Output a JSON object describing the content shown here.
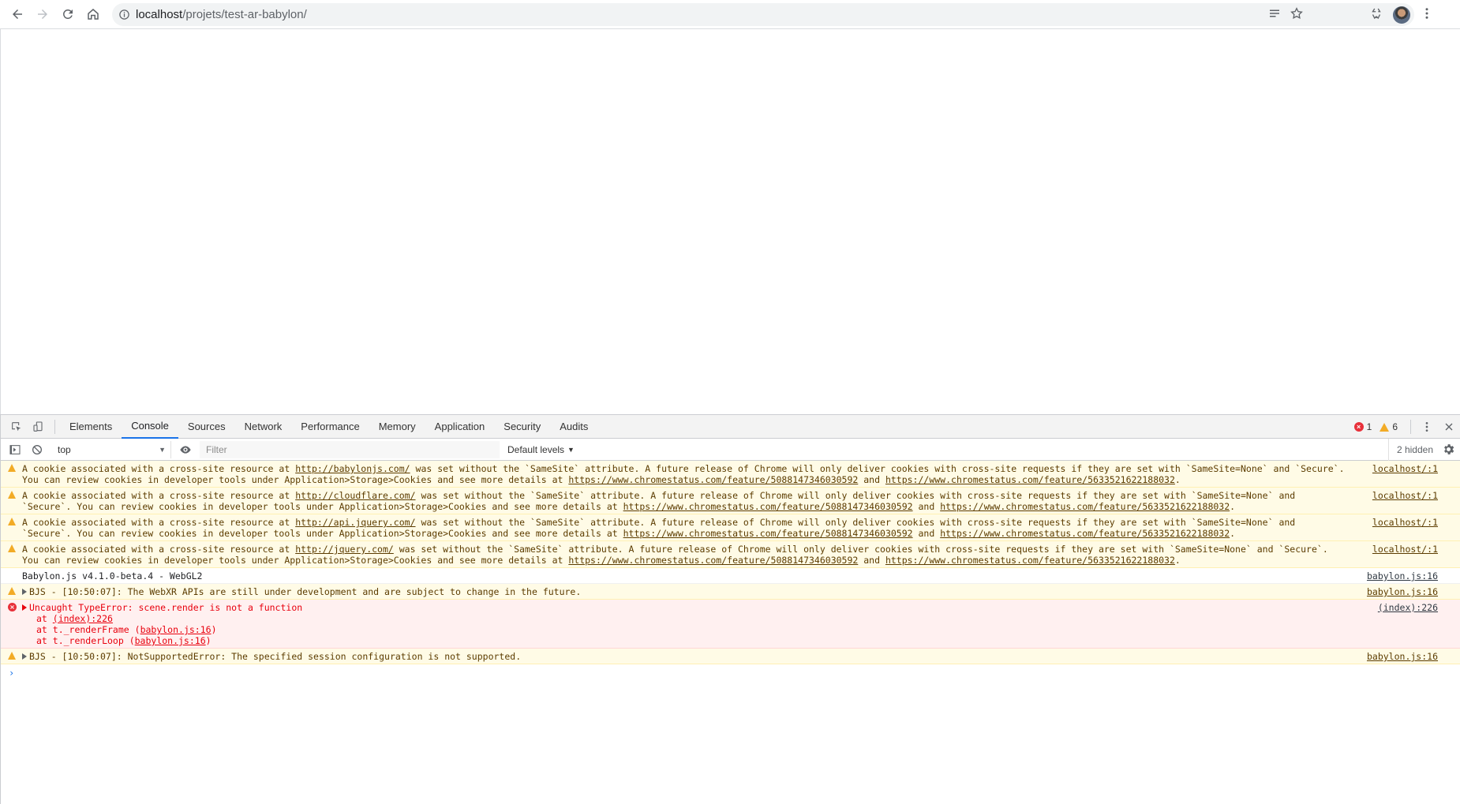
{
  "browser": {
    "url_host": "localhost",
    "url_path": "/projets/test-ar-babylon/"
  },
  "devtools": {
    "tabs": [
      "Elements",
      "Console",
      "Sources",
      "Network",
      "Performance",
      "Memory",
      "Application",
      "Security",
      "Audits"
    ],
    "active_tab": "Console",
    "error_count": "1",
    "warning_count": "6",
    "context": "top",
    "filter_placeholder": "Filter",
    "levels": "Default levels",
    "hidden": "2 hidden"
  },
  "console": {
    "cookie_prefix": "A cookie associated with a cross-site resource at ",
    "cookie_mid": " was set without the `SameSite` attribute. A future release of Chrome will only deliver cookies with cross-site requests if they are set with `SameSite=None` and `Secure`. You can review cookies in developer tools under Application>Storage>Cookies and see more details at ",
    "cookie_and": " and ",
    "cookie_end": ".",
    "cookie_link1": "https://www.chromestatus.com/feature/5088147346030592",
    "cookie_link2": "https://www.chromestatus.com/feature/5633521622188032",
    "cookie_src": "localhost/:1",
    "cookie_sites": [
      "http://babylonjs.com/",
      "http://cloudflare.com/",
      "http://api.jquery.com/",
      "http://jquery.com/"
    ],
    "info_text": "Babylon.js v4.1.0-beta.4 - WebGL2",
    "info_src": "babylon.js:16",
    "warn1_text": "BJS - [10:50:07]: The WebXR APIs are still under development and are subject to change in the future.",
    "warn1_src": "babylon.js:16",
    "error_text": "Uncaught TypeError: scene.render is not a function",
    "error_src": "(index):226",
    "stack": [
      {
        "prefix": "at ",
        "link": "(index):226",
        "suffix": ""
      },
      {
        "prefix": "at t._renderFrame (",
        "link": "babylon.js:16",
        "suffix": ")"
      },
      {
        "prefix": "at t._renderLoop (",
        "link": "babylon.js:16",
        "suffix": ")"
      }
    ],
    "warn2_text": "BJS - [10:50:07]: NotSupportedError: The specified session configuration is not supported.",
    "warn2_src": "babylon.js:16",
    "prompt": "›"
  }
}
